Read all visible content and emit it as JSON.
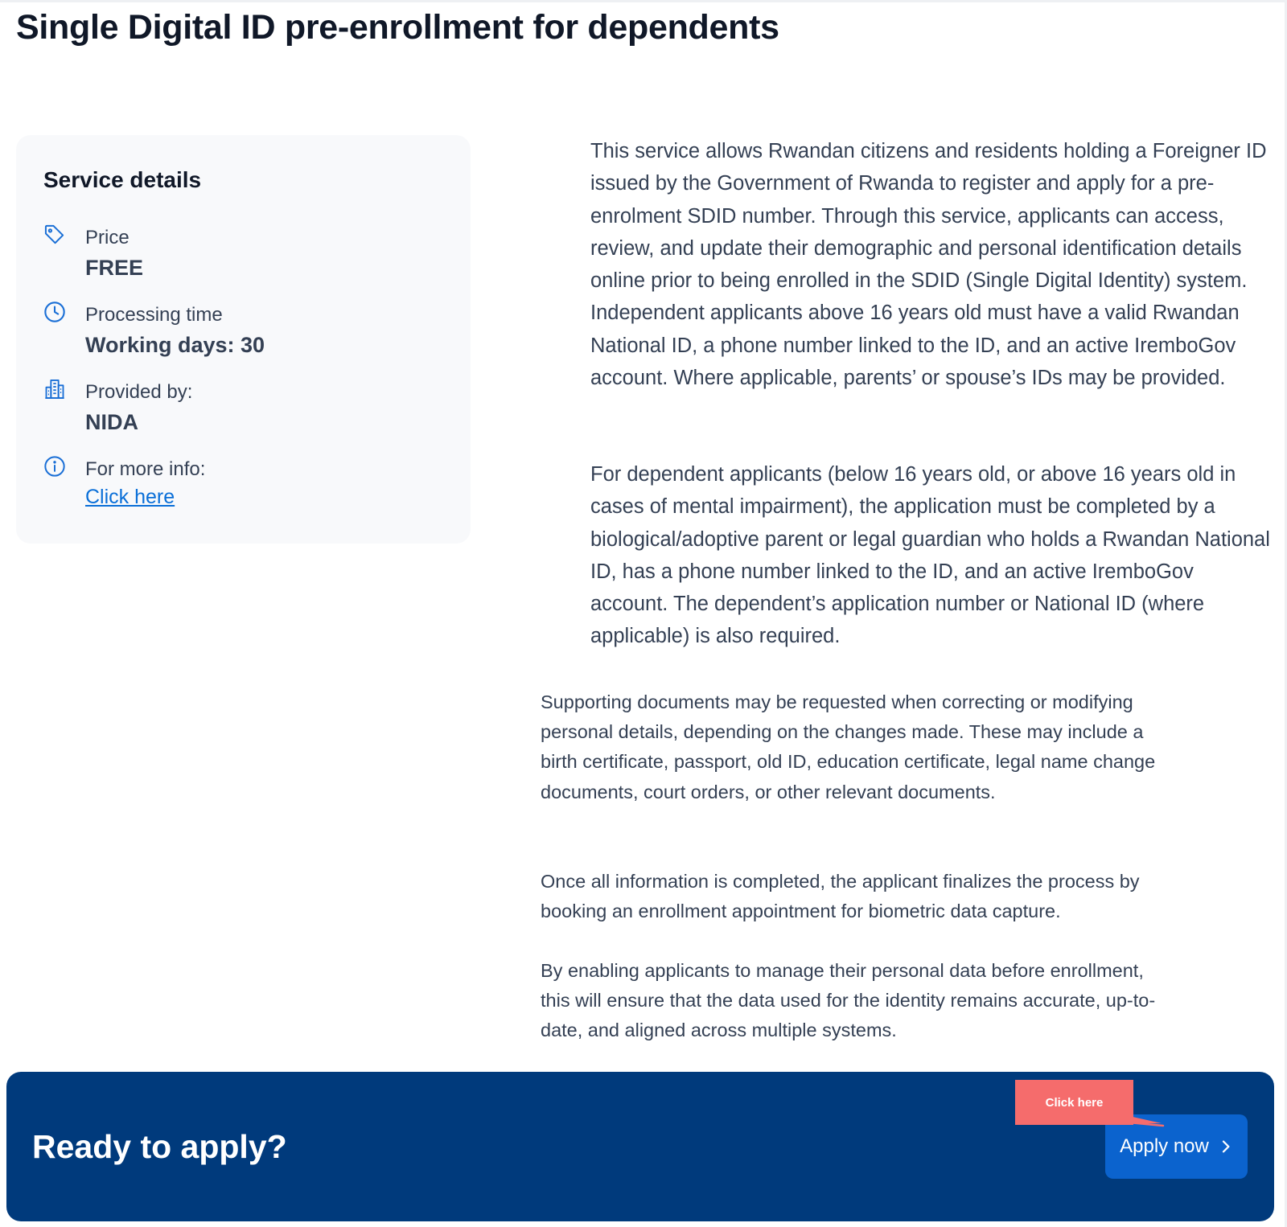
{
  "page": {
    "title": "Single Digital ID pre-enrollment for dependents"
  },
  "service_details": {
    "heading": "Service details",
    "price": {
      "icon": "price-tag-icon",
      "label": "Price",
      "value": "FREE"
    },
    "processing": {
      "icon": "clock-icon",
      "label": "Processing time",
      "value": "Working days: 30"
    },
    "provider": {
      "icon": "building-icon",
      "label": "Provided by:",
      "value": "NIDA"
    },
    "more_info": {
      "icon": "info-icon",
      "label": "For more info:",
      "link_text": "Click here"
    }
  },
  "description": {
    "p1": "This service allows Rwandan citizens and residents holding a Foreigner ID issued by the Government of Rwanda to register and apply for a pre-enrolment SDID number. Through this service, applicants can access, review, and update their demographic and personal identification details online prior to being enrolled in the SDID (Single Digital Identity) system. Independent applicants above 16 years old must have a valid Rwandan National ID, a phone number linked to the ID, and an active IremboGov account. Where applicable, parents’ or spouse’s IDs may be provided.",
    "p2": "For dependent applicants (below 16 years old, or above 16 years old in cases of mental impairment), the application must be completed by a biological/adoptive parent or legal guardian who holds a Rwandan National ID, has a phone number linked to the ID, and an active IremboGov account. The dependent’s application number or National ID (where applicable) is also required.",
    "p3": "Supporting documents may be requested when correcting or modifying personal details, depending on the changes made. These may include a birth certificate, passport, old ID, education certificate, legal name change documents, court orders, or other relevant documents.",
    "p4": "Once all information is completed, the applicant finalizes the process by booking an enrollment appointment for biometric data capture.",
    "p5": "By enabling applicants to manage their personal data before enrollment, this will ensure that the data used for the identity remains accurate, up-to-date, and aligned across multiple systems."
  },
  "cta": {
    "title": "Ready to apply?",
    "button_label": "Apply now",
    "button_icon": "chevron-right-icon"
  },
  "annotation": {
    "callout_text": "Click here",
    "color": "#f56c6c"
  },
  "colors": {
    "banner": "#003a7c",
    "button": "#0b63ce",
    "icon_blue": "#1a6fd6",
    "link": "#0a6fd8"
  }
}
